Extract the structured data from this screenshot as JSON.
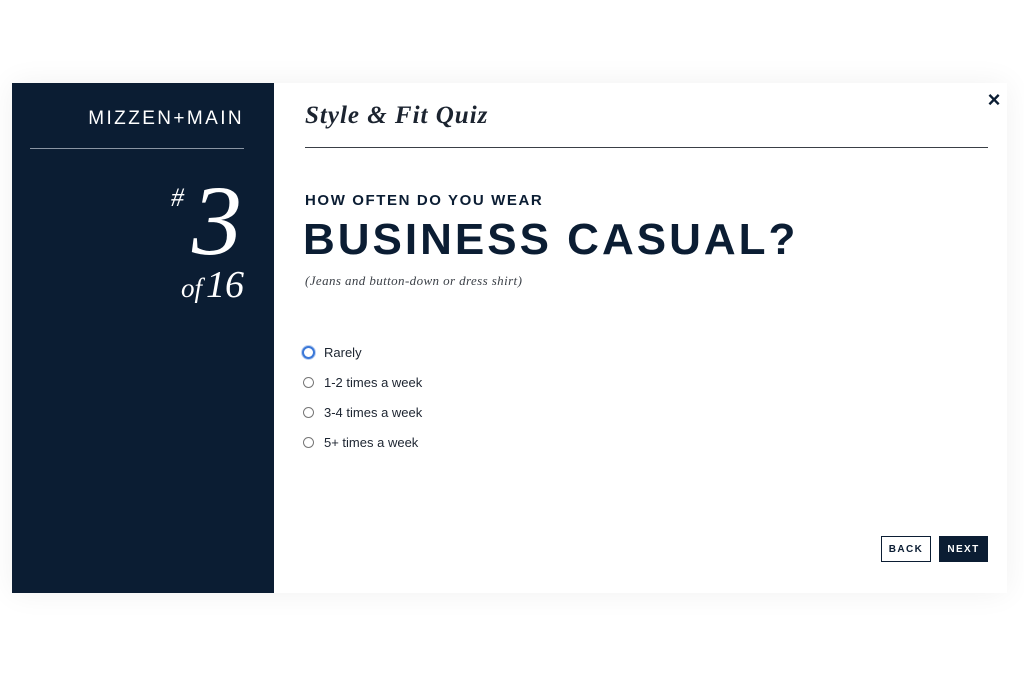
{
  "brand": {
    "name": "MIZZEN+MAIN"
  },
  "progress": {
    "hash": "#",
    "current": "3",
    "of_label": "of",
    "total": "16"
  },
  "quiz": {
    "title": "Style & Fit Quiz",
    "close_icon": "×"
  },
  "question": {
    "kicker": "HOW OFTEN DO YOU WEAR",
    "main": "BUSINESS CASUAL?",
    "subtitle": "(Jeans and button-down or dress shirt)"
  },
  "options": [
    {
      "label": "Rarely",
      "selected": false,
      "focused": true
    },
    {
      "label": "1-2 times a week",
      "selected": false,
      "focused": false
    },
    {
      "label": "3-4 times a week",
      "selected": false,
      "focused": false
    },
    {
      "label": "5+ times a week",
      "selected": false,
      "focused": false
    }
  ],
  "buttons": {
    "back": "BACK",
    "next": "NEXT"
  },
  "colors": {
    "navy": "#0b1d33",
    "focus_ring": "#3b78d8",
    "background": "#ffffff"
  }
}
